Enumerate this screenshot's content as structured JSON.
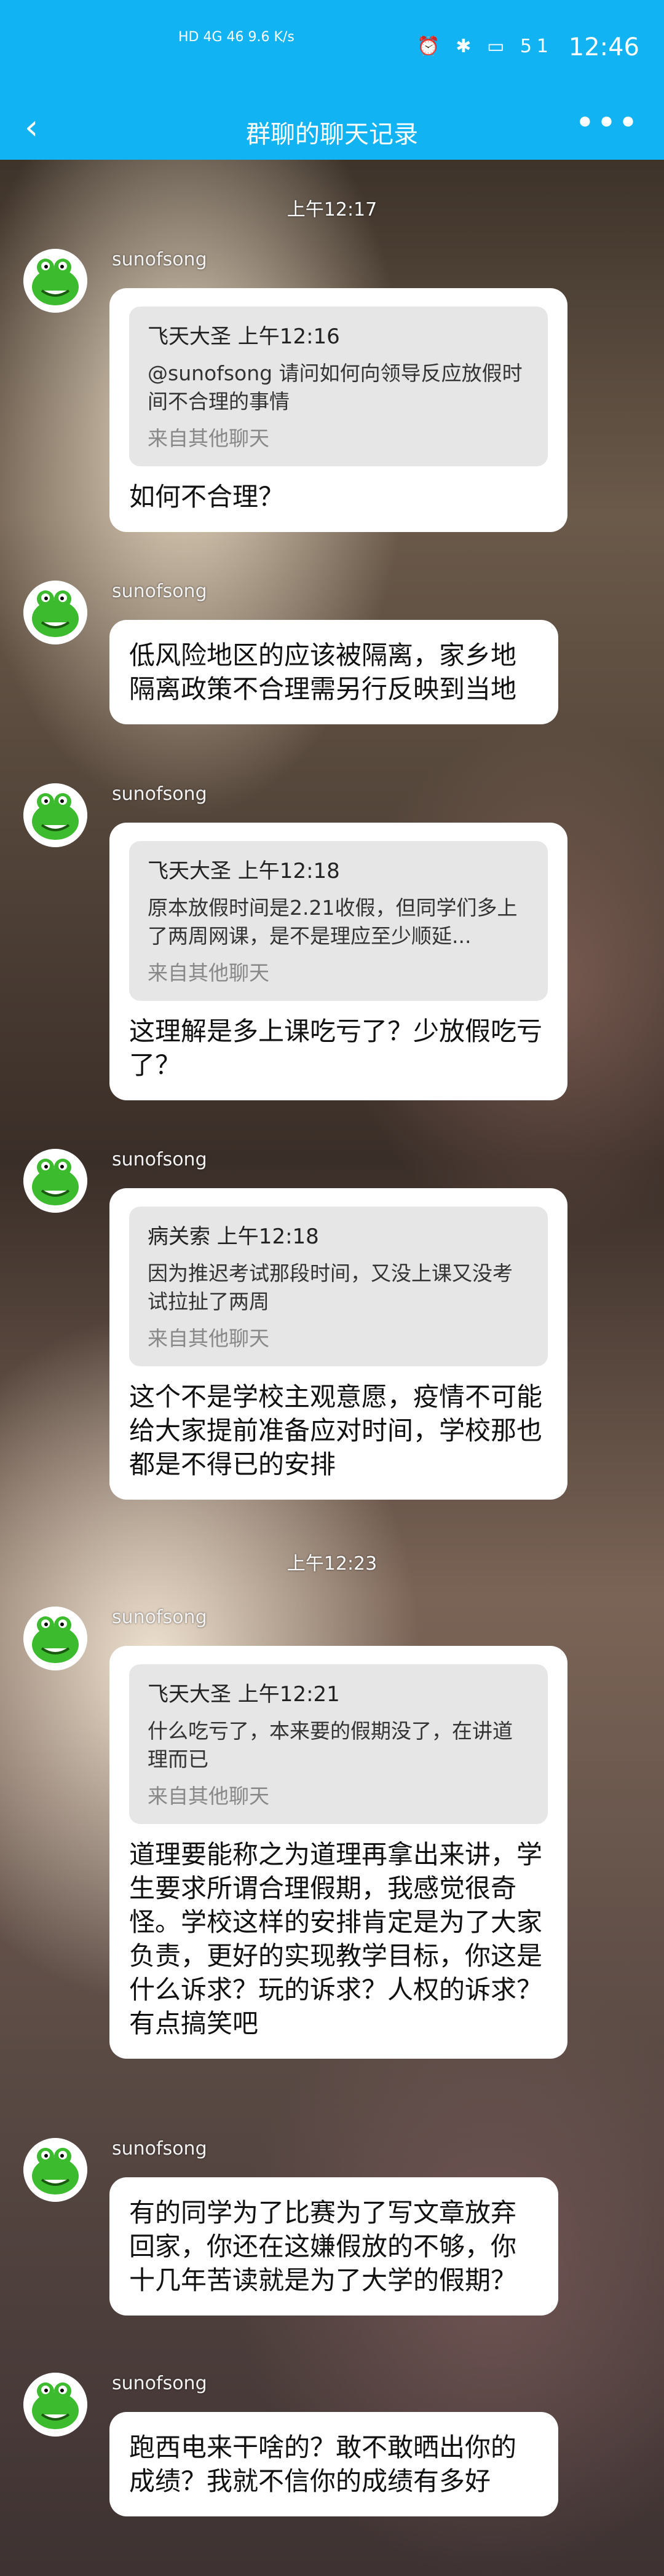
{
  "status_bar": {
    "left_text": "HD 4G 46 9.6 K/s",
    "icons": "⏰ ✱ ▭ 51",
    "time": "12:46"
  },
  "nav": {
    "back_icon": "‹",
    "title": "群聊的聊天记录",
    "more_icon": "•••"
  },
  "timestamps": [
    "上午12:17",
    "上午12:23"
  ],
  "messages": [
    {
      "sender": "sunofsong",
      "quote": {
        "author_time": "飞天大圣 上午12:16",
        "text": "@sunofsong 请问如何向领导反应放假时间不合理的事情",
        "source": "来自其他聊天"
      },
      "text": "如何不合理？"
    },
    {
      "sender": "sunofsong",
      "text": "低风险地区的应该被隔离，家乡地隔离政策不合理需另行反映到当地"
    },
    {
      "sender": "sunofsong",
      "quote": {
        "author_time": "飞天大圣 上午12:18",
        "text": "原本放假时间是2.21收假，但同学们多上了两周网课，是不是理应至少顺延...",
        "source": "来自其他聊天"
      },
      "text": "这理解是多上课吃亏了？少放假吃亏了？"
    },
    {
      "sender": "sunofsong",
      "quote": {
        "author_time": "病关索 上午12:18",
        "text": "因为推迟考试那段时间，又没上课又没考试拉扯了两周",
        "source": "来自其他聊天"
      },
      "text": "这个不是学校主观意愿，疫情不可能给大家提前准备应对时间，学校那也都是不得已的安排"
    },
    {
      "sender": "sunofsong",
      "quote": {
        "author_time": "飞天大圣 上午12:21",
        "text": "什么吃亏了，本来要的假期没了，在讲道理而已",
        "source": "来自其他聊天"
      },
      "text": "道理要能称之为道理再拿出来讲，学生要求所谓合理假期，我感觉很奇怪。学校这样的安排肯定是为了大家负责，更好的实现教学目标，你这是什么诉求？玩的诉求？人权的诉求？有点搞笑吧"
    },
    {
      "sender": "sunofsong",
      "text": "有的同学为了比赛为了写文章放弃回家，你还在这嫌假放的不够，你十几年苦读就是为了大学的假期？"
    },
    {
      "sender": "sunofsong",
      "text": "跑西电来干啥的？敢不敢晒出你的成绩？我就不信你的成绩有多好"
    }
  ],
  "colors": {
    "accent": "#12b3f2",
    "bubble": "#ffffff",
    "quote_bg": "#e6e6e6",
    "avatar_green": "#3dbb2e"
  }
}
